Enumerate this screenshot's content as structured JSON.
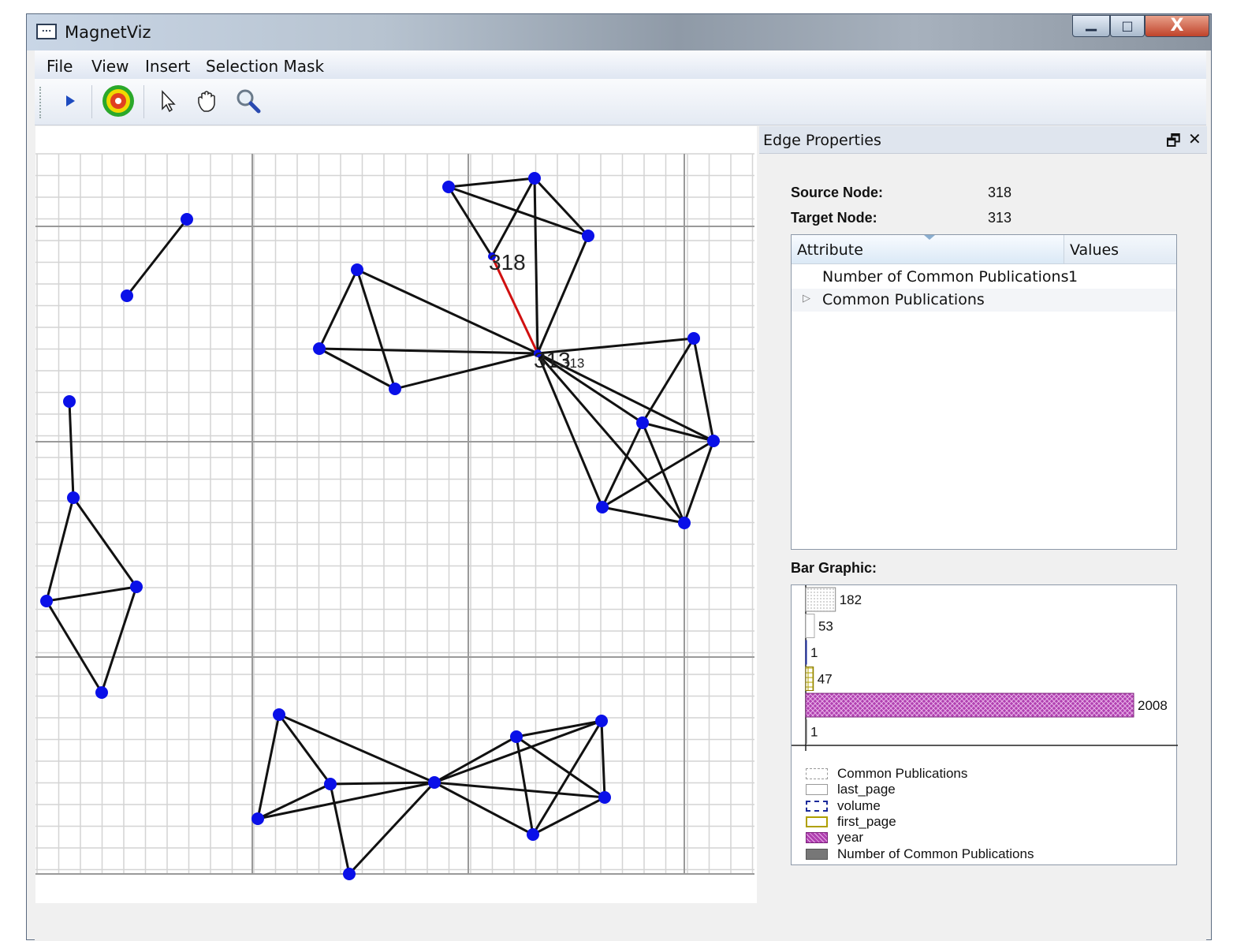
{
  "window": {
    "title": "MagnetViz"
  },
  "menu": {
    "file": "File",
    "view": "View",
    "insert": "Insert",
    "selection_mask": "Selection Mask"
  },
  "toolbar": {
    "icons": [
      "play-icon",
      "target-icon",
      "pointer-icon",
      "hand-icon",
      "magnifier-icon"
    ]
  },
  "graph": {
    "node_labels": [
      {
        "text": "318",
        "size": "large"
      },
      {
        "text": "313",
        "size": "large"
      },
      {
        "text": "313",
        "size": "small"
      }
    ],
    "highlight_color": "#d01010",
    "node_color": "#0a10e8"
  },
  "panel": {
    "title": "Edge Properties",
    "source_label": "Source Node:",
    "source_value": "318",
    "target_label": "Target Node:",
    "target_value": "313",
    "table": {
      "col_attribute": "Attribute",
      "col_values": "Values",
      "rows": [
        {
          "attribute": "Number of Common Publications",
          "value": "1",
          "expandable": false
        },
        {
          "attribute": "Common Publications",
          "value": "",
          "expandable": true
        }
      ]
    },
    "bar_title": "Bar Graphic:"
  },
  "chart_data": {
    "type": "bar",
    "orientation": "horizontal",
    "categories": [
      "Common Publications",
      "last_page",
      "volume",
      "first_page",
      "year",
      "Number of Common Publications"
    ],
    "values": [
      182,
      53,
      1,
      47,
      2008,
      1
    ],
    "value_labels": [
      "182",
      "53",
      "1",
      "47",
      "2008",
      "1"
    ],
    "legend": [
      {
        "label": "Common Publications",
        "color": "#ffffff"
      },
      {
        "label": "last_page",
        "color": "#ffffff"
      },
      {
        "label": "volume",
        "color": "#1a2a9a"
      },
      {
        "label": "first_page",
        "color": "#b0a000"
      },
      {
        "label": "year",
        "color": "#b040b0"
      },
      {
        "label": "Number of Common Publications",
        "color": "#777777"
      }
    ],
    "legend_position": "bottom"
  }
}
